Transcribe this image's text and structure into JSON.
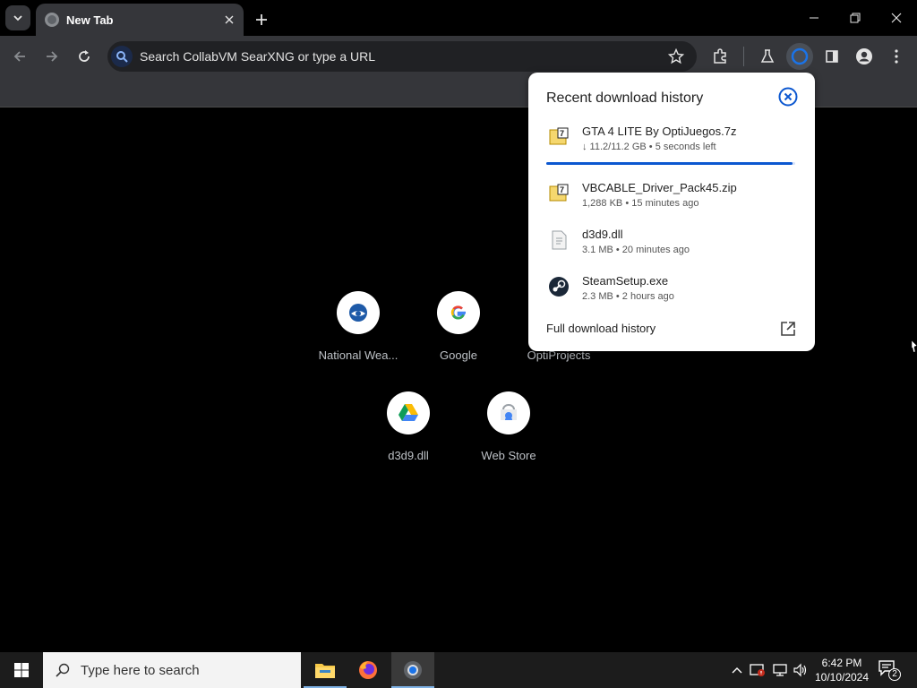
{
  "browser": {
    "tab": {
      "title": "New Tab"
    },
    "omnibox": {
      "placeholder": "Search CollabVM SearXNG or type a URL"
    }
  },
  "shortcuts": [
    {
      "label": "National Wea...",
      "icon": "noaa-icon"
    },
    {
      "label": "Google",
      "icon": "google-icon"
    },
    {
      "label": "OptiProjects",
      "icon": "optiprojects-icon"
    },
    {
      "label": "d3d9.dll",
      "icon": "google-drive-icon"
    },
    {
      "label": "Web Store",
      "icon": "web-store-icon"
    }
  ],
  "downloads": {
    "title": "Recent download history",
    "items": [
      {
        "name": "GTA 4 LITE By OptiJuegos.7z",
        "meta": "↓ 11.2/11.2 GB • 5 seconds left",
        "icon": "7z-archive-icon",
        "progress": 0.99
      },
      {
        "name": "VBCABLE_Driver_Pack45.zip",
        "meta": "1,288 KB • 15 minutes ago",
        "icon": "zip-archive-icon"
      },
      {
        "name": "d3d9.dll",
        "meta": "3.1 MB • 20 minutes ago",
        "icon": "dll-file-icon"
      },
      {
        "name": "SteamSetup.exe",
        "meta": "2.3 MB • 2 hours ago",
        "icon": "steam-icon"
      }
    ],
    "footer": "Full download history"
  },
  "taskbar": {
    "search_placeholder": "Type here to search",
    "time": "6:42 PM",
    "date": "10/10/2024",
    "notification_count": "2"
  },
  "colors": {
    "accent": "#0b57d0",
    "toolbar": "#35363a",
    "taskbar": "#1c1c1c"
  }
}
